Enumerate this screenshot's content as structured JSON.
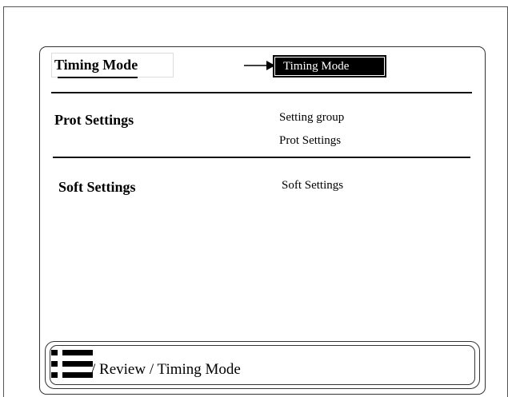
{
  "header": {
    "title": "Timing Mode",
    "selected_value": "Timing Mode"
  },
  "menu": {
    "items": [
      {
        "label": "Prot Settings",
        "value_lines": [
          "Setting group",
          "Prot Settings"
        ]
      },
      {
        "label": "Soft Settings",
        "value_lines": [
          "Soft Settings"
        ]
      }
    ]
  },
  "footer": {
    "icon": "menu-list-icon",
    "breadcrumb": "/ Review / Timing Mode"
  },
  "colors": {
    "selected_background": "#000000",
    "selected_text": "#ffffff",
    "lines": "#111111"
  }
}
